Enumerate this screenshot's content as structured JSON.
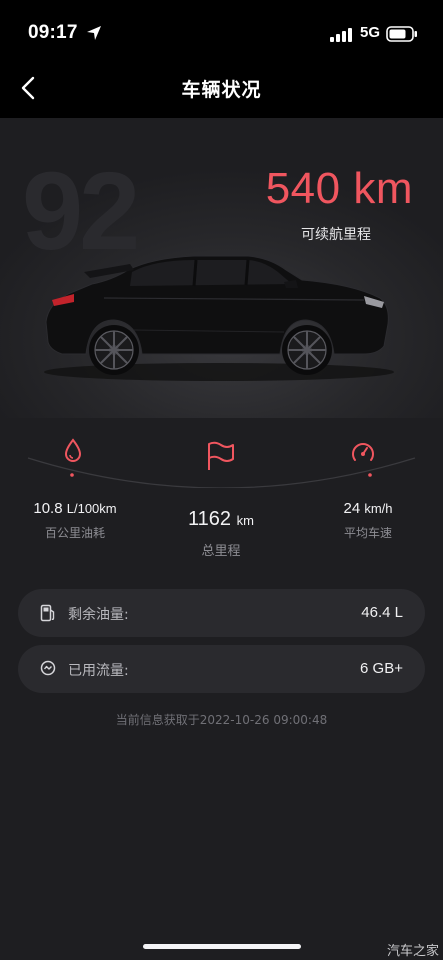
{
  "status_bar": {
    "time": "09:17",
    "network": "5G",
    "icons": [
      "location-arrow-icon",
      "signal-bars-icon",
      "battery-icon"
    ]
  },
  "nav": {
    "back_icon": "chevron-left-icon",
    "title": "车辆状况"
  },
  "hero": {
    "ghost_number": "92",
    "range_value": "540 km",
    "range_label": "可续航里程",
    "car_color": "#0f0f10"
  },
  "metrics": {
    "fuel_consumption": {
      "value": "10.8",
      "unit": "L/100km",
      "label": "百公里油耗",
      "icon": "droplet-icon"
    },
    "total_mileage": {
      "value": "1162",
      "unit": "km",
      "label": "总里程",
      "icon": "flag-icon"
    },
    "average_speed": {
      "value": "24",
      "unit": "km/h",
      "label": "平均车速",
      "icon": "speedometer-icon"
    }
  },
  "cards": [
    {
      "label": "剩余油量:",
      "value": "46.4 L",
      "icon": "fuel-pump-icon"
    },
    {
      "label": "已用流量:",
      "value": "6 GB+",
      "icon": "data-usage-icon"
    }
  ],
  "timestamp": "当前信息获取于2022-10-26 09:00:48",
  "watermark": "汽车之家",
  "colors": {
    "accent": "#f0565f",
    "background": "#1e1e21",
    "card": "#2a2a2e",
    "bar": "#000000"
  }
}
